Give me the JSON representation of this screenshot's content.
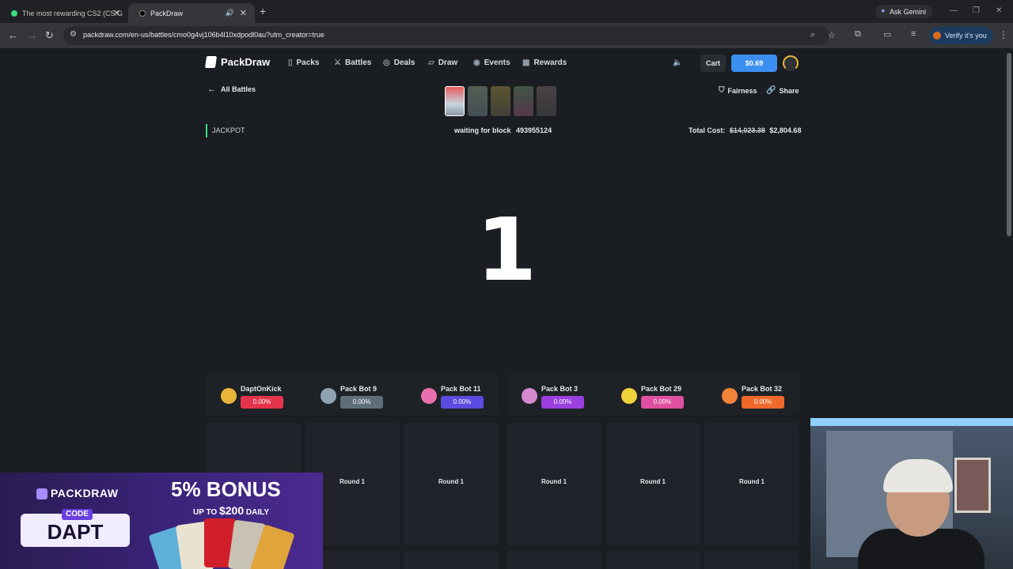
{
  "browser": {
    "tabs": [
      {
        "title": "The most rewarding CS2 (CS:G",
        "active": false
      },
      {
        "title": "PackDraw",
        "active": true
      }
    ],
    "new_tab": "+",
    "ask_gemini": "Ask Gemini",
    "url": "packdraw.com/en-us/battles/cmo0g4vj106b4l10xdpodl0au?utm_creator=true",
    "verify": "Verify it's you"
  },
  "site": {
    "logo": "PackDraw",
    "nav": [
      {
        "label": "Packs",
        "icon": "packs-icon"
      },
      {
        "label": "Battles",
        "icon": "swords-icon"
      },
      {
        "label": "Deals",
        "icon": "deals-icon"
      },
      {
        "label": "Draw",
        "icon": "draw-icon"
      },
      {
        "label": "Events",
        "icon": "events-icon"
      },
      {
        "label": "Rewards",
        "icon": "gift-icon"
      }
    ],
    "cart": "Cart",
    "balance": "$0.69"
  },
  "battle": {
    "back": "All Battles",
    "fairness": "Fairness",
    "share": "Share",
    "mode": "JACKPOT",
    "waiting_label": "waiting for block",
    "block": "493955124",
    "total_label": "Total Cost:",
    "total_old": "$14,023.38",
    "total_new": "$2,804.68",
    "countdown": "1",
    "players": [
      {
        "name": "DaptOnKick",
        "pct": "0.00%",
        "color": "#e5334b",
        "avatar": "#e8b53a"
      },
      {
        "name": "Pack Bot 9",
        "pct": "0.00%",
        "color": "#5f6f7a",
        "avatar": "#8fa3b5"
      },
      {
        "name": "Pack Bot 11",
        "pct": "0.00%",
        "color": "#5b4be0",
        "avatar": "#e970b0"
      },
      {
        "name": "Pack Bot 3",
        "pct": "0.00%",
        "color": "#9b3fe0",
        "avatar": "#d58ad0"
      },
      {
        "name": "Pack Bot 29",
        "pct": "0.00%",
        "color": "#e04fa0",
        "avatar": "#f0d23a"
      },
      {
        "name": "Pack Bot 32",
        "pct": "0.00%",
        "color": "#ef6a2a",
        "avatar": "#f2843a"
      }
    ],
    "round_label": "Round 1"
  },
  "promo": {
    "brand": "PACKDRAW",
    "code_label": "CODE",
    "code": "DAPT",
    "bonus": "5% BONUS",
    "daily_prefix": "UP TO",
    "daily_amount": "$200",
    "daily_suffix": "DAILY"
  }
}
